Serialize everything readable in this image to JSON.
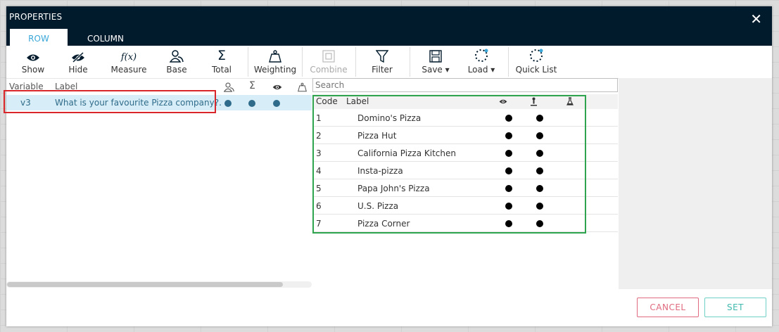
{
  "dialog": {
    "title": "PROPERTIES",
    "close_symbol": "✕"
  },
  "tabs": [
    {
      "label": "ROW",
      "active": true
    },
    {
      "label": "COLUMN",
      "active": false
    }
  ],
  "toolbar": {
    "show": "Show",
    "hide": "Hide",
    "measure": "Measure",
    "base": "Base",
    "total": "Total",
    "weighting": "Weighting",
    "combine": "Combine",
    "filter": "Filter",
    "save": "Save ▾",
    "load": "Load ▾",
    "quick_list": "Quick List",
    "measure_glyph": "f(x)",
    "total_glyph": "Σ"
  },
  "variables": {
    "headers": {
      "variable": "Variable",
      "label": "Label",
      "total_glyph": "Σ"
    },
    "rows": [
      {
        "variable": "v3",
        "label": "What is your favourite Pizza company?."
      }
    ]
  },
  "search": {
    "placeholder": "Search",
    "value": ""
  },
  "codes": {
    "headers": {
      "code": "Code",
      "label": "Label"
    },
    "rows": [
      {
        "code": "1",
        "label": "Domino's Pizza"
      },
      {
        "code": "2",
        "label": "Pizza Hut"
      },
      {
        "code": "3",
        "label": "California Pizza Kitchen"
      },
      {
        "code": "4",
        "label": "Insta-pizza"
      },
      {
        "code": "5",
        "label": "Papa John's Pizza"
      },
      {
        "code": "6",
        "label": "U.S. Pizza"
      },
      {
        "code": "7",
        "label": "Pizza Corner"
      }
    ]
  },
  "buttons": {
    "cancel": "CANCEL",
    "set": "SET"
  },
  "colors": {
    "header_bg": "#021b2c",
    "accent": "#3aa7d8",
    "cancel": "#e06a7f",
    "set": "#3fb9ae",
    "highlight_red": "#d9262a",
    "highlight_green": "#2ea44f"
  }
}
